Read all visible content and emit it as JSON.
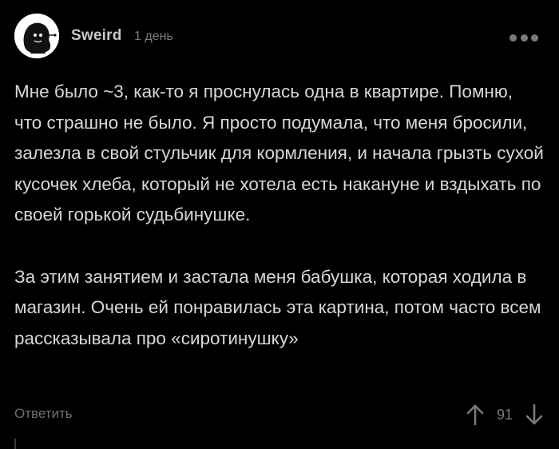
{
  "comment": {
    "author": "Sweird",
    "timestamp": "1 день",
    "paragraphs": [
      "Мне было ~3, как-то я проснулась одна в квартире. Помню, что страшно не было. Я просто подумала, что меня бросили, залезла в свой стульчик для кормления, и начала грызть сухой кусочек хлеба, который не хотела есть накануне и вздыхать по своей горькой судьбинушке.",
      "За этим занятием и застала меня бабушка, которая ходила в магазин. Очень ей понравилась эта картина, потом часто всем рассказывала про «сиротинушку»"
    ],
    "reply_label": "Ответить",
    "score": "91",
    "icons": {
      "more": "more-dots-icon",
      "upvote": "arrow-up-icon",
      "downvote": "arrow-down-icon"
    }
  },
  "colors": {
    "background": "#000000",
    "text": "#d7d7d7",
    "muted": "#7a7a7a"
  }
}
